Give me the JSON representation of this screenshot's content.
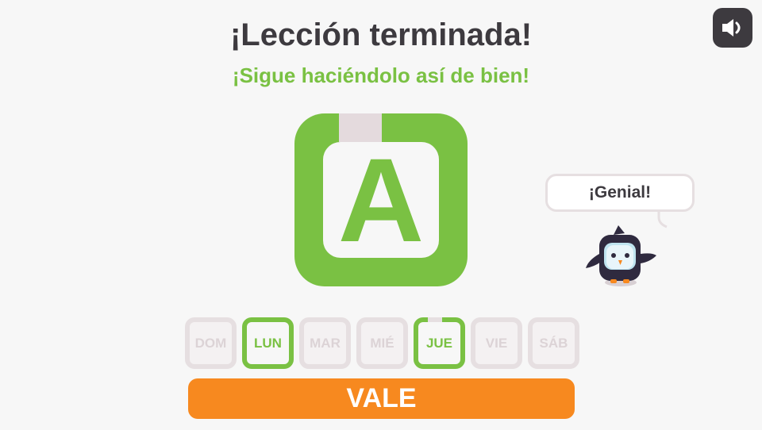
{
  "header": {
    "title": "¡Lección terminada!",
    "subtitle": "¡Sigue haciéndolo así de bien!"
  },
  "sound": {
    "icon": "speaker-icon"
  },
  "grade": {
    "letter": "A"
  },
  "mascot": {
    "speech": "¡Genial!",
    "icon": "penguin-icon"
  },
  "week": {
    "days": [
      {
        "label": "DOM",
        "active": false
      },
      {
        "label": "LUN",
        "active": true
      },
      {
        "label": "MAR",
        "active": false
      },
      {
        "label": "MIÉ",
        "active": false
      },
      {
        "label": "JUE",
        "active": true
      },
      {
        "label": "VIE",
        "active": false
      },
      {
        "label": "SÁB",
        "active": false
      }
    ]
  },
  "actions": {
    "ok_label": "VALE"
  },
  "colors": {
    "green": "#7ac143",
    "orange": "#f7891f",
    "dark": "#3d3a3f",
    "inactive": "#e6dfe1"
  }
}
